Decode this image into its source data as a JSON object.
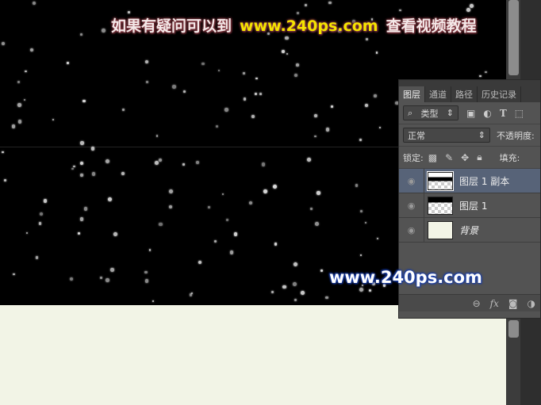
{
  "banner": {
    "left": "如果有疑问可以到",
    "url": "www.240ps.com",
    "right": "查看视频教程"
  },
  "watermark": "www.240ps.com",
  "layers_panel": {
    "tabs": [
      "图层",
      "通道",
      "路径",
      "历史记录"
    ],
    "filter_kind": "类型",
    "blend_mode": "正常",
    "opacity_label": "不透明度:",
    "lock_label": "锁定:",
    "fill_label": "填充:",
    "layers": [
      {
        "name": "图层 1 副本",
        "selected": true
      },
      {
        "name": "图层 1",
        "selected": false
      },
      {
        "name": "背景",
        "selected": false
      }
    ],
    "footer_icons": [
      "link-icon",
      "fx-icon",
      "mask-icon",
      "adjustment-icon"
    ]
  },
  "colors": {
    "canvas": "#000000",
    "background_layer": "#f2f4e6",
    "selected_layer": "#576378"
  }
}
